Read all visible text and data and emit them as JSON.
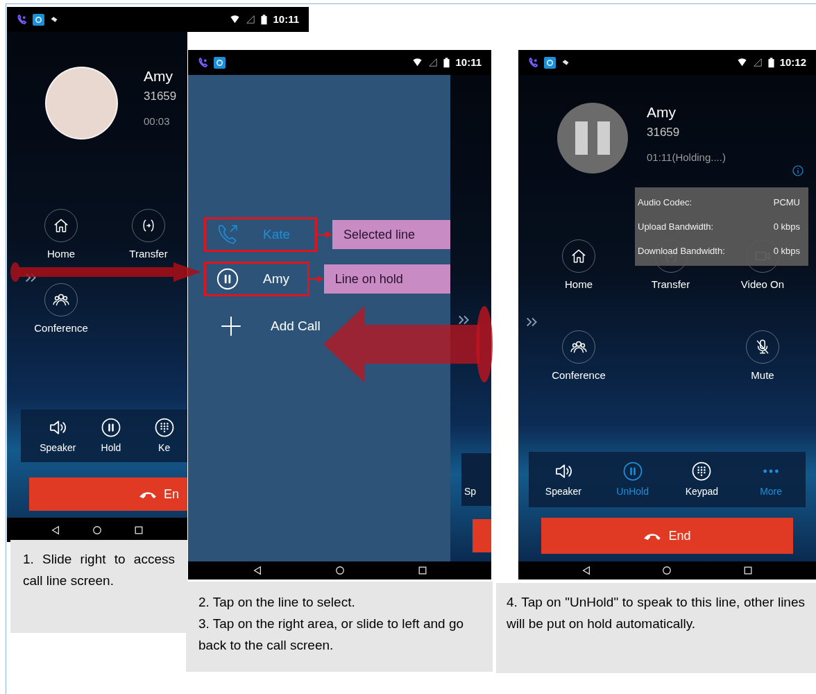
{
  "screen_1": {
    "status_time": "10:11",
    "contact": {
      "name": "Amy",
      "number": "31659",
      "timer": "00:03"
    },
    "action_rows": [
      [
        {
          "kind": "home",
          "label": "Home"
        },
        {
          "kind": "transfer",
          "label": "Transfer"
        }
      ],
      [
        {
          "kind": "conference",
          "label": "Conference"
        }
      ]
    ],
    "controls": [
      {
        "kind": "speaker",
        "label": "Speaker",
        "active": false
      },
      {
        "kind": "hold",
        "label": "Hold",
        "active": false
      },
      {
        "kind": "keypad",
        "label": "Ke",
        "active": false
      }
    ],
    "end_label": "En"
  },
  "screen_2": {
    "status_time": "10:11",
    "lines": [
      {
        "kind": "transfer",
        "name": "Kate",
        "selected": true,
        "callout": "Selected line"
      },
      {
        "kind": "hold",
        "name": "Amy",
        "selected": false,
        "callout": "Line on hold"
      }
    ],
    "add_call": "Add Call",
    "behind_control": "Sp"
  },
  "screen_3": {
    "status_time": "10:12",
    "contact": {
      "name": "Amy",
      "number": "31659",
      "timer": "01:11(Holding....)"
    },
    "info_rows": [
      {
        "label": "Audio Codec:",
        "value": "PCMU"
      },
      {
        "label": "Upload Bandwidth:",
        "value": "0 kbps"
      },
      {
        "label": "Download Bandwidth:",
        "value": "0 kbps"
      }
    ],
    "action_rows": [
      [
        {
          "kind": "home",
          "label": "Home"
        },
        {
          "kind": "transfer",
          "label": "Transfer"
        },
        {
          "kind": "video",
          "label": "Video On"
        }
      ],
      [
        {
          "kind": "conference",
          "label": "Conference"
        },
        {
          "kind": "mute",
          "label": "Mute"
        }
      ]
    ],
    "controls": [
      {
        "kind": "speaker",
        "label": "Speaker",
        "active": false
      },
      {
        "kind": "hold",
        "label": "UnHold",
        "active": true
      },
      {
        "kind": "keypad",
        "label": "Keypad",
        "active": false
      },
      {
        "kind": "more",
        "label": "More",
        "active": true
      }
    ],
    "end_label": "End"
  },
  "captions": [
    {
      "lines": [
        "1. Slide right to access call line screen."
      ]
    },
    {
      "lines": [
        "2. Tap on the line to select.",
        "3. Tap on the right area, or slide to left and go back to the call screen."
      ]
    },
    {
      "lines": [
        "4. Tap on \"UnHold\" to speak to this line, other lines will be put on hold automatically."
      ]
    }
  ]
}
